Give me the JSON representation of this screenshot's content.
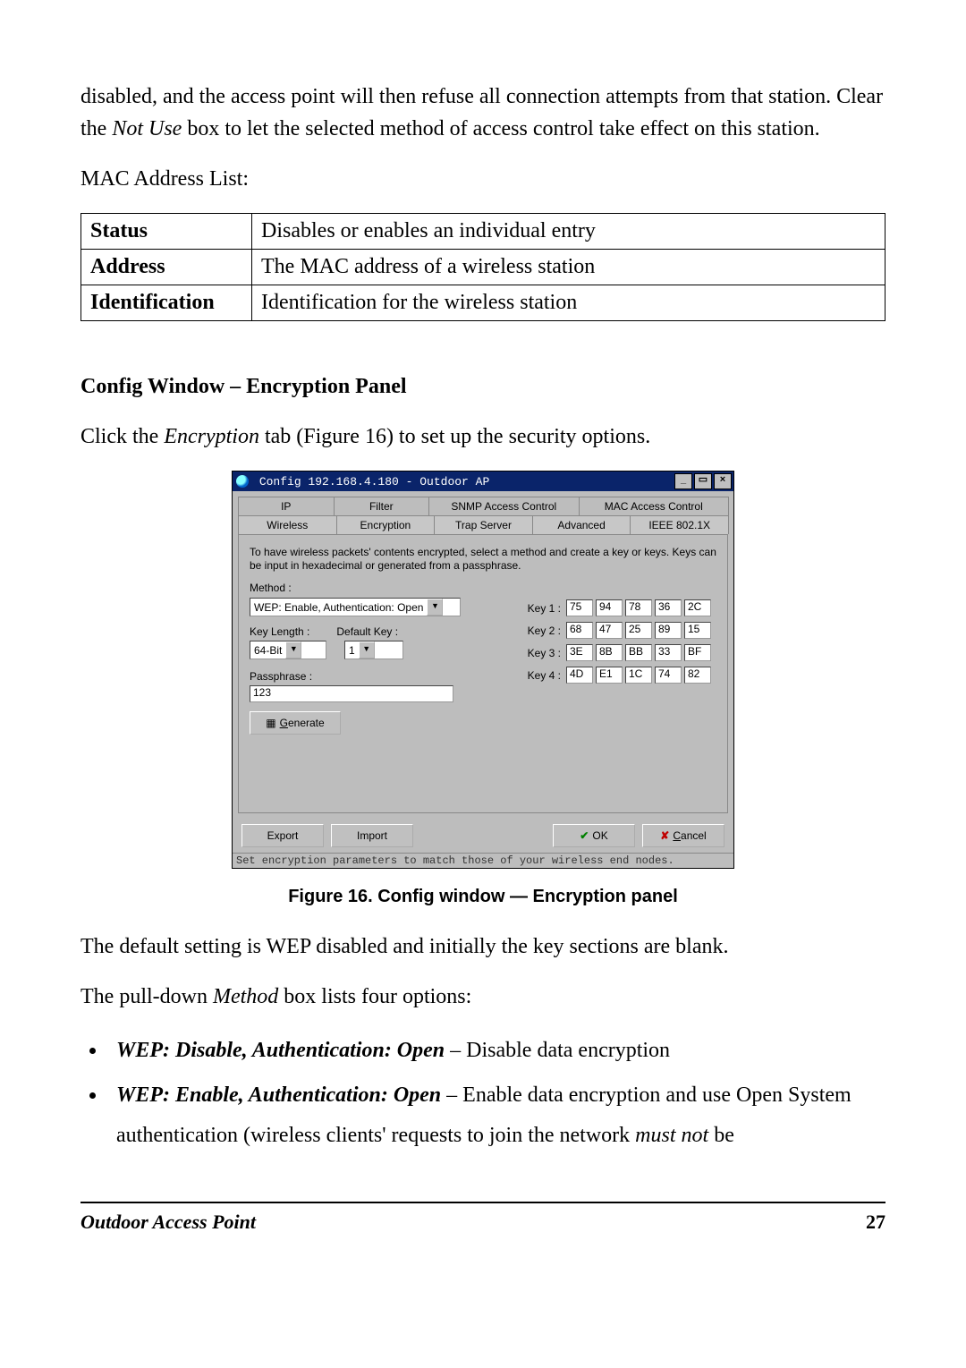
{
  "para_top": "disabled, and the access point will then refuse all connection attempts from that station. Clear the ",
  "para_top_em": "Not Use",
  "para_top_after": " box to let the selected method of access control take effect on this station.",
  "mac_list_heading": "MAC Address List:",
  "table": {
    "rows": [
      {
        "label": "Status",
        "desc": "Disables or enables an individual entry"
      },
      {
        "label": "Address",
        "desc": "The MAC address of a wireless station"
      },
      {
        "label": "Identification",
        "desc": "Identification for the wireless station"
      }
    ]
  },
  "section_heading": "Config Window – Encryption Panel",
  "section_intro_pre": "Click the ",
  "section_intro_em": "Encryption",
  "section_intro_post": " tab (Figure 16) to set up the security options.",
  "win": {
    "title": "Config 192.168.4.180 - Outdoor AP",
    "minimize": "_",
    "restore": "▭",
    "close": "×",
    "tabs_back": [
      "IP",
      "Filter",
      "SNMP Access Control",
      "MAC Access Control"
    ],
    "tabs_front": [
      "Wireless",
      "Encryption",
      "Trap Server",
      "Advanced",
      "IEEE 802.1X"
    ],
    "intro": "To have wireless packets' contents encrypted, select a method and create a key or keys. Keys can be input in hexadecimal or generated from a passphrase.",
    "method_label": "Method :",
    "method_value": "WEP: Enable, Authentication: Open",
    "keylen_label": "Key Length :",
    "keylen_value": "64-Bit",
    "defkey_label": "Default Key :",
    "defkey_value": "1",
    "pass_label": "Passphrase :",
    "pass_value": "123",
    "gen_label": "Generate",
    "keys": [
      {
        "label": "Key 1 :",
        "v": [
          "75",
          "94",
          "78",
          "36",
          "2C"
        ]
      },
      {
        "label": "Key 2 :",
        "v": [
          "68",
          "47",
          "25",
          "89",
          "15"
        ]
      },
      {
        "label": "Key 3 :",
        "v": [
          "3E",
          "8B",
          "BB",
          "33",
          "BF"
        ]
      },
      {
        "label": "Key 4 :",
        "v": [
          "4D",
          "E1",
          "1C",
          "74",
          "82"
        ]
      }
    ],
    "export": "Export",
    "import": "Import",
    "ok": "OK",
    "cancel": "Cancel",
    "status": "Set encryption parameters to match those of your wireless end nodes."
  },
  "caption": "Figure 16.  Config window — Encryption panel",
  "p_after1": "The default setting is WEP disabled and initially the key sections are blank.",
  "p_after2_pre": "The pull-down ",
  "p_after2_em": "Method",
  "p_after2_post": " box lists four options:",
  "opts": [
    {
      "bi": "WEP: Disable, Authentication: Open",
      "rest": " – Disable data encryption"
    },
    {
      "bi": "WEP: Enable, Authentication: Open",
      "rest_a": " – Enable data encryption and use Open System authentication (wireless clients' requests to join the network ",
      "rest_em": "must not",
      "rest_b": " be"
    }
  ],
  "footer_title": "Outdoor Access Point",
  "page_number": "27"
}
